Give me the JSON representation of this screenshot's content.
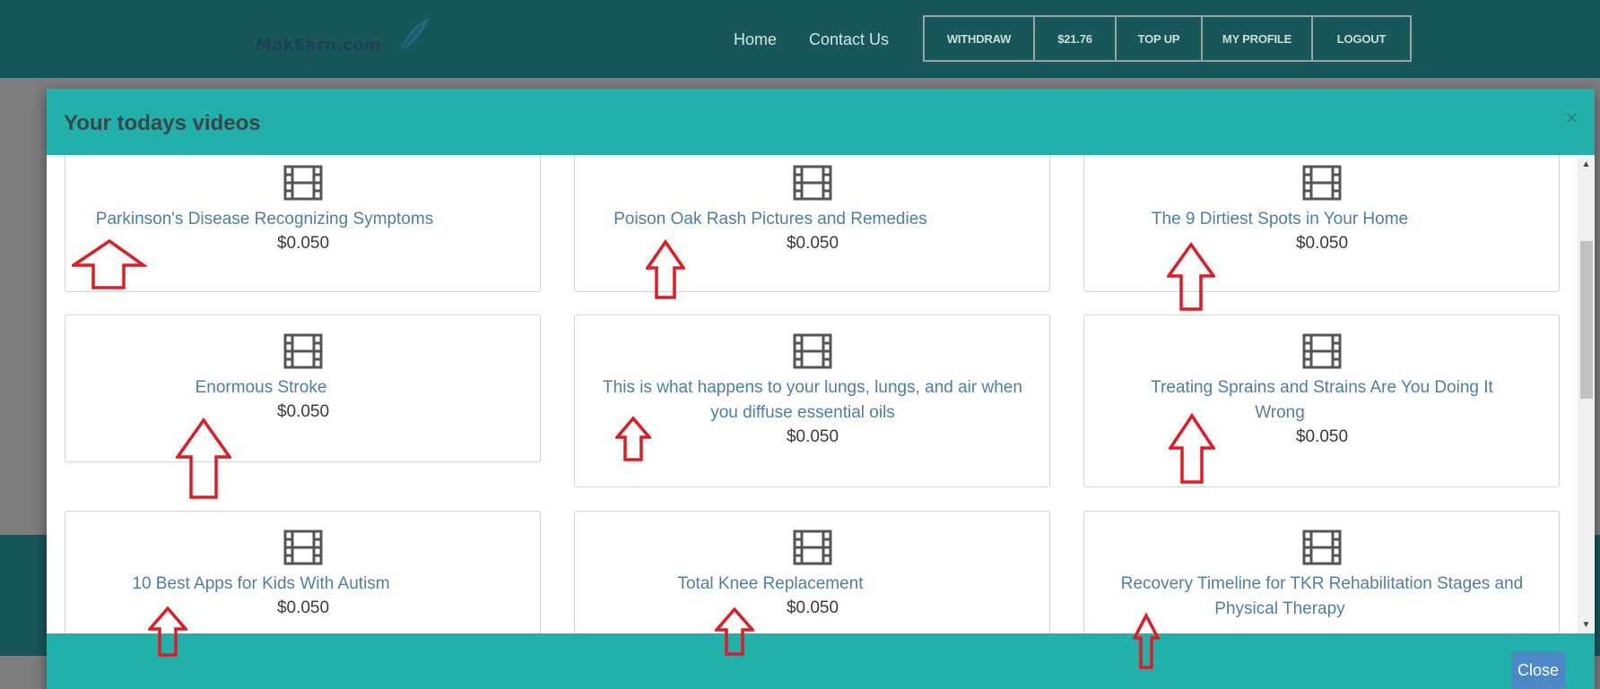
{
  "navbar": {
    "logo_text": "MakEarn.com",
    "links": [
      "Home",
      "Contact Us"
    ],
    "buttons": {
      "withdraw": "WITHDRAW",
      "balance": "$21.76",
      "topup": "TOP UP",
      "profile": "MY PROFILE",
      "logout": "LOGOUT"
    }
  },
  "modal": {
    "title": "Your todays videos",
    "close_x": "×",
    "close_button": "Close",
    "videos": [
      {
        "title": "Parkinson's Disease Recognizing Symptoms",
        "price": "$0.050"
      },
      {
        "title": "Poison Oak Rash Pictures and Remedies",
        "price": "$0.050"
      },
      {
        "title": "The 9 Dirtiest Spots in Your Home",
        "price": "$0.050"
      },
      {
        "title": "Enormous Stroke",
        "price": "$0.050"
      },
      {
        "title_line1": "This is what happens to your lungs, lungs, and air when",
        "title_line2": "you diffuse essential oils",
        "price": "$0.050"
      },
      {
        "title_line1": "Treating Sprains and Strains Are You Doing It",
        "title_line2": "Wrong",
        "price": "$0.050"
      },
      {
        "title": "10 Best Apps for Kids With Autism",
        "price": "$0.050"
      },
      {
        "title": "Total Knee Replacement",
        "price": "$0.050"
      },
      {
        "title_line1": "Recovery Timeline for TKR Rehabilitation Stages and",
        "title_line2": "Physical Therapy"
      }
    ],
    "icon": "film-icon",
    "annotation_color": "#e01b24"
  }
}
